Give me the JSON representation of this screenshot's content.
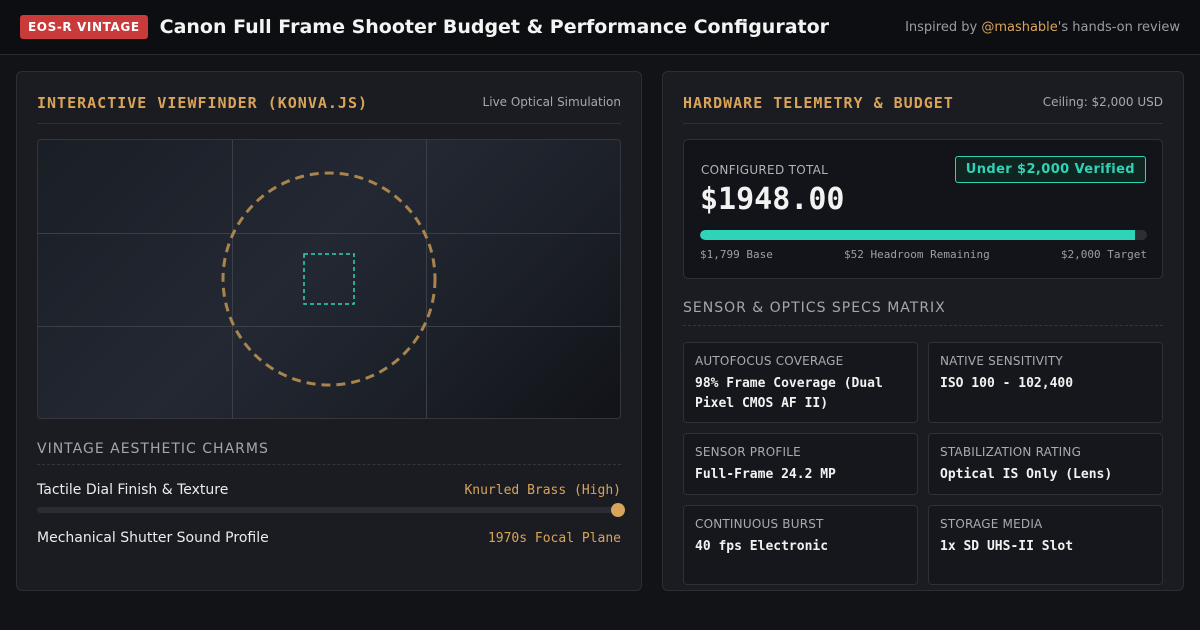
{
  "header": {
    "badge": "EOS-R VINTAGE",
    "title": "Canon Full Frame Shooter Budget & Performance Configurator",
    "credit_prefix": "Inspired by ",
    "credit_handle": "@mashable",
    "credit_suffix": "'s hands-on review"
  },
  "viewfinder_panel": {
    "title": "INTERACTIVE VIEWFINDER (KONVA.JS)",
    "meta": "Live Optical Simulation",
    "charms_heading": "VINTAGE AESTHETIC CHARMS",
    "charms": [
      {
        "label": "Tactile Dial Finish & Texture",
        "value": "Knurled Brass (High)",
        "level": 1.0
      },
      {
        "label": "Mechanical Shutter Sound Profile",
        "value": "1970s Focal Plane"
      }
    ]
  },
  "telemetry_panel": {
    "title": "HARDWARE TELEMETRY & BUDGET",
    "meta": "Ceiling: $2,000 USD",
    "budget": {
      "label": "CONFIGURED TOTAL",
      "total": "$1948.00",
      "status": "Under $2,000 Verified",
      "fill_fraction": 0.974,
      "legend_left": "$1,799 Base",
      "legend_mid": "$52 Headroom Remaining",
      "legend_right": "$2,000 Target"
    },
    "specs_heading": "SENSOR & OPTICS SPECS MATRIX",
    "specs": [
      {
        "key": "AUTOFOCUS COVERAGE",
        "value": "98% Frame Coverage (Dual Pixel CMOS AF II)"
      },
      {
        "key": "NATIVE SENSITIVITY",
        "value": "ISO 100 - 102,400"
      },
      {
        "key": "SENSOR PROFILE",
        "value": "Full-Frame 24.2 MP"
      },
      {
        "key": "STABILIZATION RATING",
        "value": "Optical IS Only (Lens)"
      },
      {
        "key": "CONTINUOUS BURST",
        "value": "40 fps Electronic"
      },
      {
        "key": "STORAGE MEDIA",
        "value": "1x SD UHS-II Slot"
      }
    ]
  },
  "colors": {
    "accent_gold": "#d8a45a",
    "accent_teal": "#2fd3b8",
    "badge_red": "#c93a3a"
  }
}
